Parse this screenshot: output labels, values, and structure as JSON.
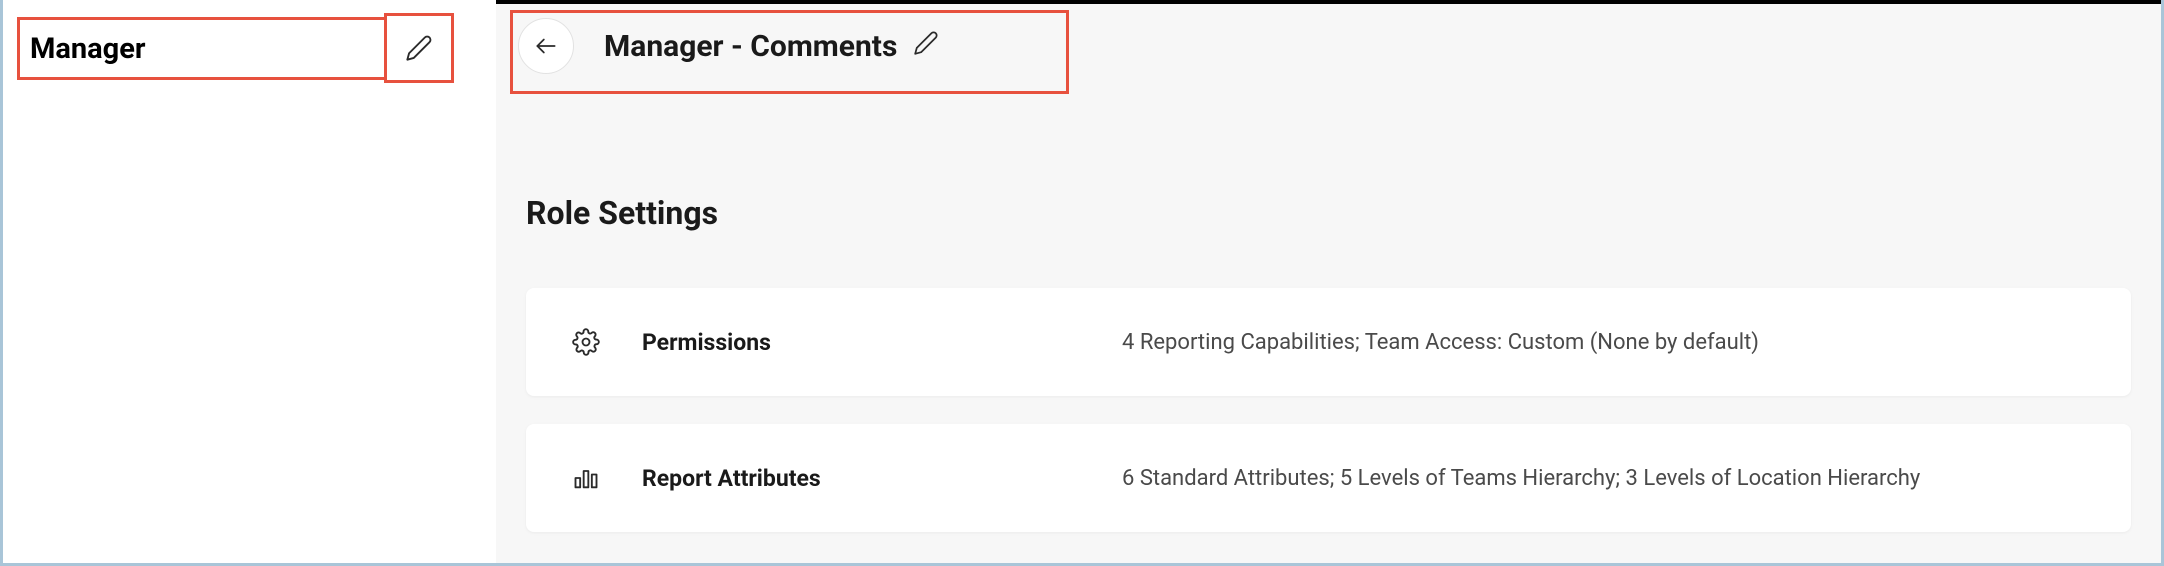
{
  "sidebar": {
    "selected_role": "Manager"
  },
  "header": {
    "page_title": "Manager - Comments"
  },
  "section": {
    "title": "Role Settings"
  },
  "cards": {
    "permissions": {
      "title": "Permissions",
      "description": "4 Reporting Capabilities; Team Access: Custom (None by default)"
    },
    "report_attributes": {
      "title": "Report Attributes",
      "description": "6 Standard Attributes; 5 Levels of Teams Hierarchy; 3 Levels of Location Hierarchy"
    }
  }
}
